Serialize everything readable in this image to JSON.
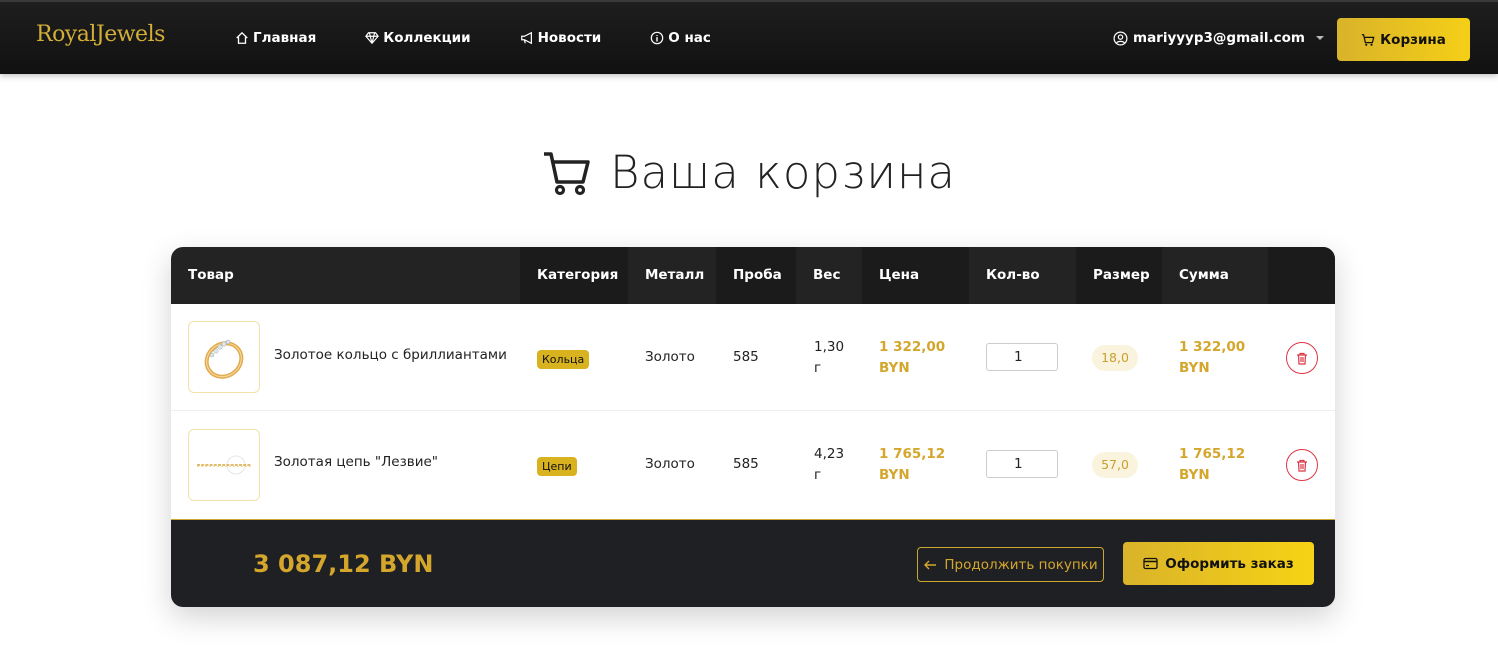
{
  "nav": {
    "brand": "RoyalJewels",
    "links": [
      {
        "label": "Главная",
        "icon": "home-icon"
      },
      {
        "label": "Коллекции",
        "icon": "gem-icon"
      },
      {
        "label": "Новости",
        "icon": "megaphone-icon"
      },
      {
        "label": "О нас",
        "icon": "info-icon"
      }
    ],
    "user_email": "mariyyyp3@gmail.com",
    "cart_label": "Корзина"
  },
  "page": {
    "title": "Ваша корзина"
  },
  "table": {
    "headers": [
      "Товар",
      "Категория",
      "Металл",
      "Проба",
      "Вес",
      "Цена",
      "Кол-во",
      "Размер",
      "Сумма"
    ],
    "rows": [
      {
        "name": "Золотое кольцо с бриллиантами",
        "category": "Кольца",
        "metal": "Золото",
        "probe": "585",
        "weight": "1,30 г",
        "price": "1 322,00 BYN",
        "quantity": "1",
        "size": "18,0",
        "sum": "1 322,00 BYN"
      },
      {
        "name": "Золотая цепь \"Лезвие\"",
        "category": "Цепи",
        "metal": "Золото",
        "probe": "585",
        "weight": "4,23 г",
        "price": "1 765,12 BYN",
        "quantity": "1",
        "size": "57,0",
        "sum": "1 765,12 BYN"
      }
    ]
  },
  "footer": {
    "total": "3 087,12 BYN",
    "continue_label": "Продолжить покупки",
    "checkout_label": "Оформить заказ"
  },
  "colors": {
    "accent": "#d4a72c",
    "dark": "#232323",
    "danger": "#dc3545"
  }
}
